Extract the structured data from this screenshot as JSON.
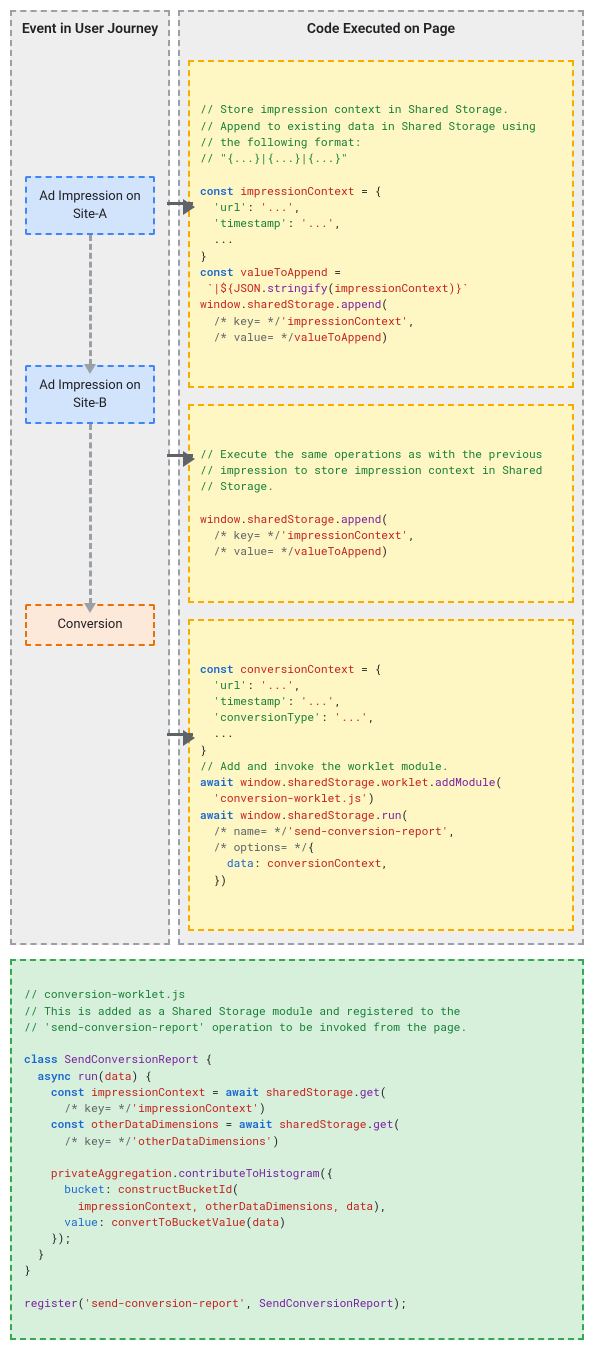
{
  "left": {
    "title": "Event in User Journey",
    "box1": "Ad Impression on Site-A",
    "box2": "Ad Impression on Site-B",
    "box3": "Conversion"
  },
  "right": {
    "title": "Code Executed on Page",
    "code1": {
      "c1": "// Store impression context in Shared Storage.",
      "c2": "// Append to existing data in Shared Storage using",
      "c3": "// the following format:",
      "c4": "// \"{...}|{...}|{...}\"",
      "kw_const1": "const",
      "var_ic": "impressionContext",
      "eq": " = {",
      "l_url": "'url'",
      "l_ts": "'timestamp'",
      "colon_dots": ": ",
      "dots": "'...'",
      "ellipsis_line": "  ...",
      "close_brace": "}",
      "kw_const2": "const",
      "var_vta": "valueToAppend",
      "eq2": " =",
      "tmpl_open": " `|${",
      "json": "JSON",
      "stringify": "stringify",
      "tmpl_close": ")}`",
      "window": "window",
      "sharedStorage": "sharedStorage",
      "append": "append",
      "key_c": "/* key= */",
      "key_v": "'impressionContext'",
      "val_c": "/* value= */",
      "val_v": "valueToAppend"
    },
    "code2": {
      "c1": "// Execute the same operations as with the previous",
      "c2": "// impression to store impression context in Shared",
      "c3": "// Storage.",
      "window": "window",
      "sharedStorage": "sharedStorage",
      "append": "append",
      "key_c": "/* key= */",
      "key_v": "'impressionContext'",
      "val_c": "/* value= */",
      "val_v": "valueToAppend"
    },
    "code3": {
      "kw_const": "const",
      "var_cc": "conversionContext",
      "eq": " = {",
      "l_url": "'url'",
      "l_ts": "'timestamp'",
      "l_ct": "'conversionType'",
      "dots": "'...'",
      "ellipsis_line": "  ...",
      "close_brace": "}",
      "c1": "// Add and invoke the worklet module.",
      "kw_await1": "await",
      "window": "window",
      "sharedStorage": "sharedStorage",
      "worklet": "worklet",
      "addModule": "addModule",
      "modstr": "'conversion-worklet.js'",
      "kw_await2": "await",
      "run": "run",
      "name_c": "/* name= */",
      "name_v": "'send-conversion-report'",
      "opt_c": "/* options= */",
      "data_lbl": "data",
      "data_v": "conversionContext",
      "opt_close": "})"
    }
  },
  "bottom": {
    "c1": "// conversion-worklet.js",
    "c2": "// This is added as a Shared Storage module and registered to the",
    "c3": "// 'send-conversion-report' operation to be invoked from the page.",
    "kw_class": "class",
    "cls": "SendConversionReport",
    "kw_async": "async",
    "fn_run": "run",
    "param": "data",
    "kw_const1": "const",
    "var_ic": "impressionContext",
    "kw_await1": "await",
    "ss": "sharedStorage",
    "get": "get",
    "key_c": "/* key= */",
    "key_ic": "'impressionContext'",
    "kw_const2": "const",
    "var_odd": "otherDataDimensions",
    "kw_await2": "await",
    "key_odd": "'otherDataDimensions'",
    "pa": "privateAggregation",
    "cth": "contributeToHistogram",
    "bucket_lbl": "bucket",
    "cbi": "constructBucketId",
    "args": "impressionContext, otherDataDimensions, data",
    "value_lbl": "value",
    "ctbv": "convertToBucketValue",
    "arg_data": "data",
    "close": "});",
    "reg": "register",
    "reg_name": "'send-conversion-report'",
    "reg_cls": "SendConversionReport"
  }
}
